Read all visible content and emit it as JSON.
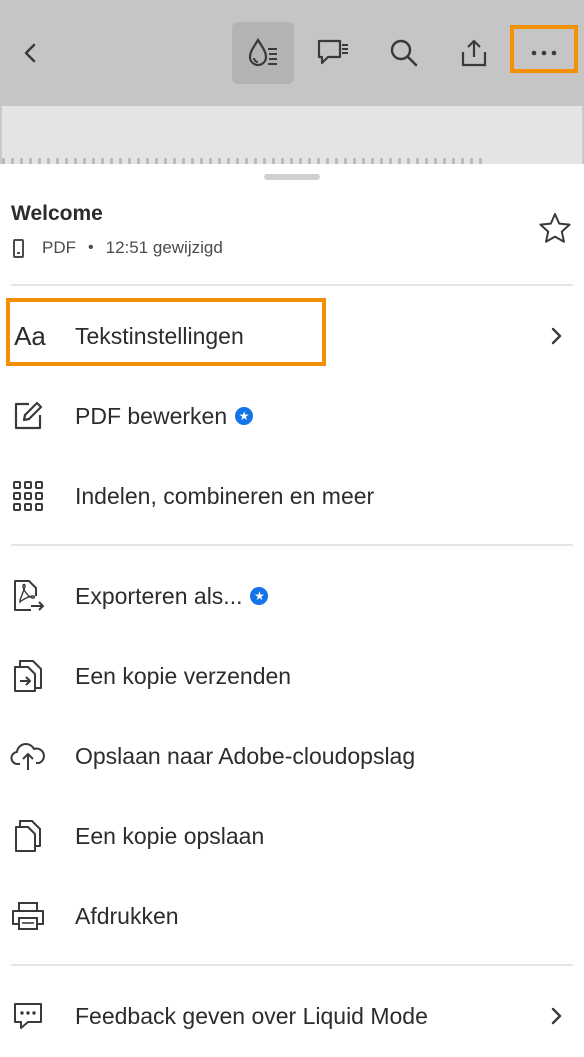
{
  "toolbar": {
    "icons": [
      "back-icon",
      "liquid-mode-icon",
      "comment-icon",
      "search-icon",
      "share-icon",
      "more-icon"
    ]
  },
  "document": {
    "title": "Welcome",
    "file_type": "PDF",
    "separator": "•",
    "modified": "12:51 gewijzigd"
  },
  "menu": {
    "group1": [
      {
        "icon": "text-settings-icon",
        "glyph": "Aa",
        "label": "Tekstinstellingen",
        "chevron": true
      },
      {
        "icon": "edit-pdf-icon",
        "label": "PDF bewerken",
        "premium": true
      },
      {
        "icon": "grid-icon",
        "label": "Indelen, combineren en meer"
      }
    ],
    "group2": [
      {
        "icon": "export-pdf-icon",
        "label": "Exporteren als...",
        "premium": true
      },
      {
        "icon": "send-copy-icon",
        "label": "Een kopie verzenden"
      },
      {
        "icon": "cloud-upload-icon",
        "label": "Opslaan naar Adobe-cloudopslag"
      },
      {
        "icon": "save-copy-icon",
        "label": "Een kopie opslaan"
      },
      {
        "icon": "print-icon",
        "label": "Afdrukken"
      }
    ],
    "group3": [
      {
        "icon": "feedback-icon",
        "label": "Feedback geven over Liquid Mode",
        "chevron": true
      }
    ],
    "premium_glyph": "★"
  },
  "colors": {
    "toolbar_bg": "#c5c5c5",
    "highlight": "#f39106",
    "premium_badge": "#1473e6",
    "text": "#2c2c2c"
  }
}
